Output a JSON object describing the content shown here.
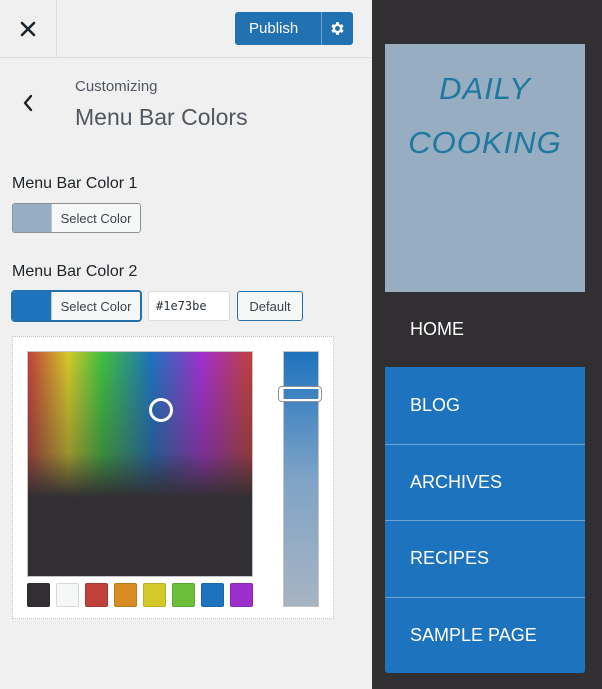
{
  "topbar": {
    "publish_label": "Publish"
  },
  "section": {
    "breadcrumb": "Customizing",
    "title": "Menu Bar Colors"
  },
  "controls": {
    "color1": {
      "label": "Menu Bar Color 1",
      "button_label": "Select Color",
      "swatch": "#97aec2"
    },
    "color2": {
      "label": "Menu Bar Color 2",
      "button_label": "Select Color",
      "swatch": "#1e73be",
      "hex_value": "#1e73be",
      "default_label": "Default"
    }
  },
  "picker": {
    "palette": [
      "#322f33",
      "#f6f7f7",
      "#c0403b",
      "#d88b23",
      "#d4c92a",
      "#6bbf3a",
      "#1e73be",
      "#9c2fcc"
    ]
  },
  "preview": {
    "site_title_line1": "DAILY",
    "site_title_line2": "COOKING",
    "menu": [
      "HOME",
      "BLOG",
      "ARCHIVES",
      "RECIPES",
      "SAMPLE PAGE"
    ],
    "colors": {
      "header_bg": "#97aec2",
      "menu_bg": "#1e73be",
      "page_bg": "#322f33",
      "title": "#20779f"
    }
  }
}
